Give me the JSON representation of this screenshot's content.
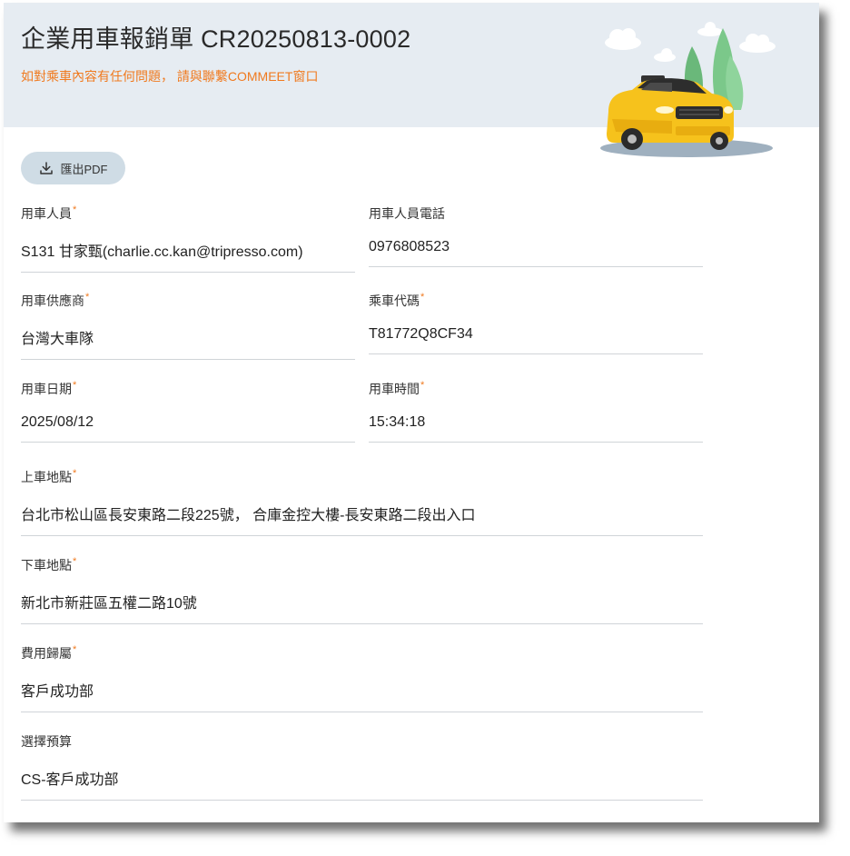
{
  "header": {
    "title": "企業用車報銷單 CR20250813-0002",
    "notice": "如對乘車內容有任何問題， 請與聯繫COMMEET窗口"
  },
  "toolbar": {
    "export_label": "匯出PDF"
  },
  "colors": {
    "header_bg": "#e6ecf2",
    "accent_orange": "#f07a1f",
    "button_bg": "#cfdce5"
  },
  "form": {
    "passenger": {
      "label": "用車人員",
      "required": "*",
      "value": "S131 甘家甄(charlie.cc.kan@tripresso.com)"
    },
    "passenger_phone": {
      "label": "用車人員電話",
      "value": "0976808523"
    },
    "vendor": {
      "label": "用車供應商",
      "required": "*",
      "value": "台灣大車隊"
    },
    "ride_code": {
      "label": "乘車代碼",
      "required": "*",
      "value": "T81772Q8CF34"
    },
    "date": {
      "label": "用車日期",
      "required": "*",
      "value": "2025/08/12"
    },
    "time": {
      "label": "用車時間",
      "required": "*",
      "value": "15:34:18"
    },
    "pickup": {
      "label": "上車地點",
      "required": "*",
      "value": "台北市松山區長安東路二段225號， 合庫金控大樓-長安東路二段出入口"
    },
    "dropoff": {
      "label": "下車地點",
      "required": "*",
      "value": "新北市新莊區五權二路10號"
    },
    "cost_center": {
      "label": "費用歸屬",
      "required": "*",
      "value": "客戶成功部"
    },
    "budget": {
      "label": "選擇預算",
      "value": "CS-客戶成功部"
    }
  }
}
